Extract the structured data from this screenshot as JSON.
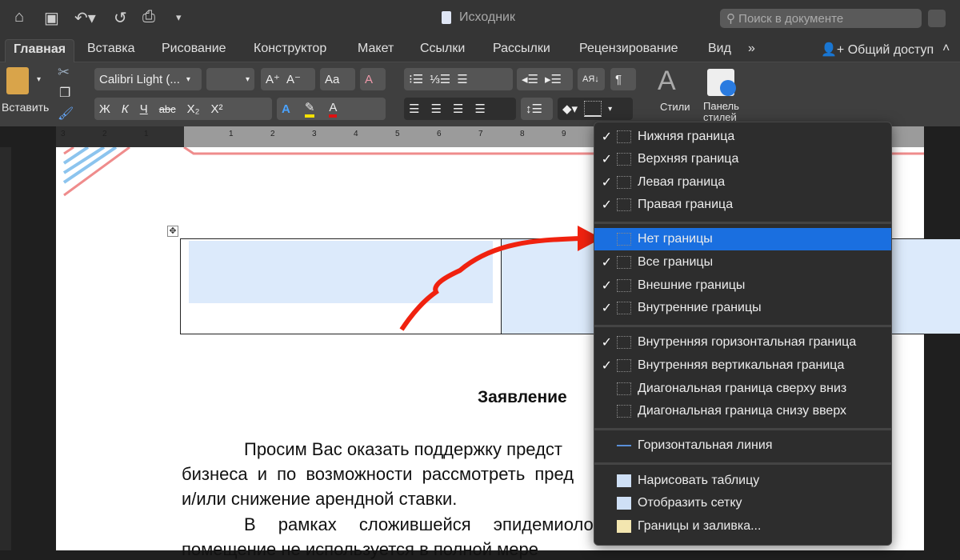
{
  "titlebar": {
    "title": "Исходник",
    "search_placeholder": "Поиск в документе"
  },
  "tabs": [
    "Главная",
    "Вставка",
    "Рисование",
    "Конструктор",
    "Макет",
    "Ссылки",
    "Рассылки",
    "Рецензирование",
    "Вид"
  ],
  "active_tab": "Главная",
  "share_label": "Общий доступ",
  "ribbon": {
    "paste_label": "Вставить",
    "font_name": "Calibri Light (...",
    "font_size": "",
    "bold": "Ж",
    "italic": "К",
    "underline": "Ч",
    "strike": "abc",
    "subscript": "X₂",
    "superscript": "X²",
    "styles_label": "Стили",
    "styles_pane_label": "Панель стилей"
  },
  "ruler_ticks": [
    "3",
    "2",
    "1",
    "1",
    "2",
    "3",
    "4",
    "5",
    "6",
    "7",
    "8",
    "9"
  ],
  "menu": {
    "items": [
      {
        "label": "Нижняя граница",
        "checked": true
      },
      {
        "label": "Верхняя граница",
        "checked": true
      },
      {
        "label": "Левая граница",
        "checked": true
      },
      {
        "label": "Правая граница",
        "checked": true
      },
      {
        "label": "Нет границы",
        "checked": false,
        "highlighted": true
      },
      {
        "label": "Все границы",
        "checked": true
      },
      {
        "label": "Внешние границы",
        "checked": true
      },
      {
        "label": "Внутренние границы",
        "checked": true
      },
      {
        "label": "Внутренняя горизонтальная граница",
        "checked": true
      },
      {
        "label": "Внутренняя вертикальная граница",
        "checked": true
      },
      {
        "label": "Диагональная граница сверху вниз",
        "checked": false
      },
      {
        "label": "Диагональная граница снизу вверх",
        "checked": false
      },
      {
        "label": "Горизонтальная линия",
        "checked": false
      },
      {
        "label": "Нарисовать таблицу",
        "checked": false
      },
      {
        "label": "Отобразить сетку",
        "checked": false
      },
      {
        "label": "Границы и заливка...",
        "checked": false
      }
    ]
  },
  "document": {
    "heading": "Заявление",
    "lines": [
      "Просим Вас оказать поддержку предст",
      "бизнеса и по возможности рассмотреть пред",
      "и/или снижение арендной ставки.",
      "В рамках сложившейся эпидемиолог",
      "помещение не используется в полной мере"
    ]
  },
  "colors": {
    "accent": "#1a6fe0",
    "arrow": "#f0220f"
  }
}
